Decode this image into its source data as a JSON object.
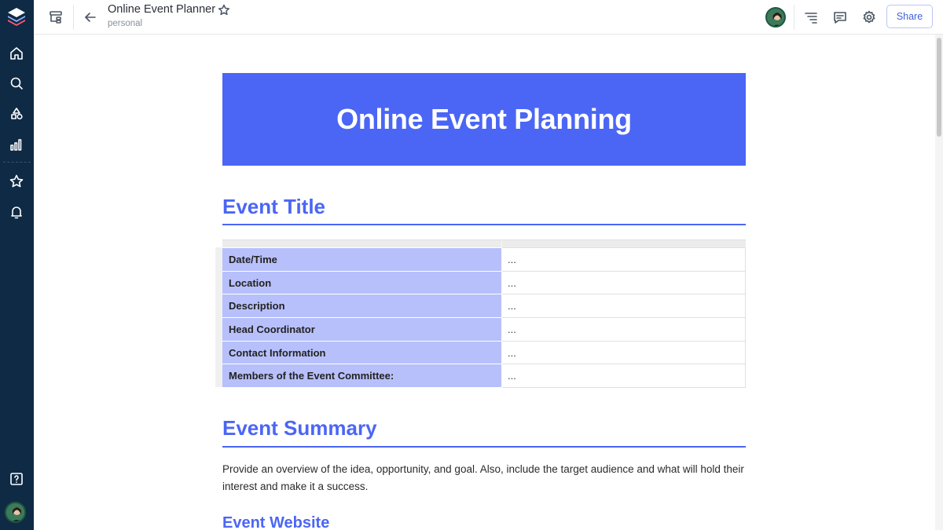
{
  "header": {
    "title": "Online Event Planner",
    "subtitle": "personal",
    "share_label": "Share"
  },
  "document": {
    "banner_title": "Online Event Planning",
    "section1_heading": "Event Title",
    "table_rows": [
      {
        "label": "Date/Time",
        "value": "..."
      },
      {
        "label": "Location",
        "value": "..."
      },
      {
        "label": "Description",
        "value": "..."
      },
      {
        "label": "Head Coordinator",
        "value": "..."
      },
      {
        "label": "Contact Information",
        "value": "..."
      },
      {
        "label": "Members of the Event Committee:",
        "value": "..."
      }
    ],
    "section2_heading": "Event Summary",
    "summary_text": "Provide an overview of the idea, opportunity, and goal. Also, include the target audience and what will hold their interest and make it a success.",
    "section3_heading": "Event Website"
  },
  "colors": {
    "accent": "#4b66f5",
    "table_label_bg": "#b7c0fb",
    "sidebar_bg": "#0f2a44"
  },
  "icons": {
    "sidebar": [
      "logo-icon",
      "home-icon",
      "search-icon",
      "shapes-icon",
      "analytics-icon",
      "star-icon",
      "bell-icon",
      "help-icon"
    ],
    "topbar": [
      "workspace-icon",
      "back-arrow-icon",
      "favorite-star-icon",
      "outline-icon",
      "comment-icon",
      "settings-icon"
    ]
  }
}
